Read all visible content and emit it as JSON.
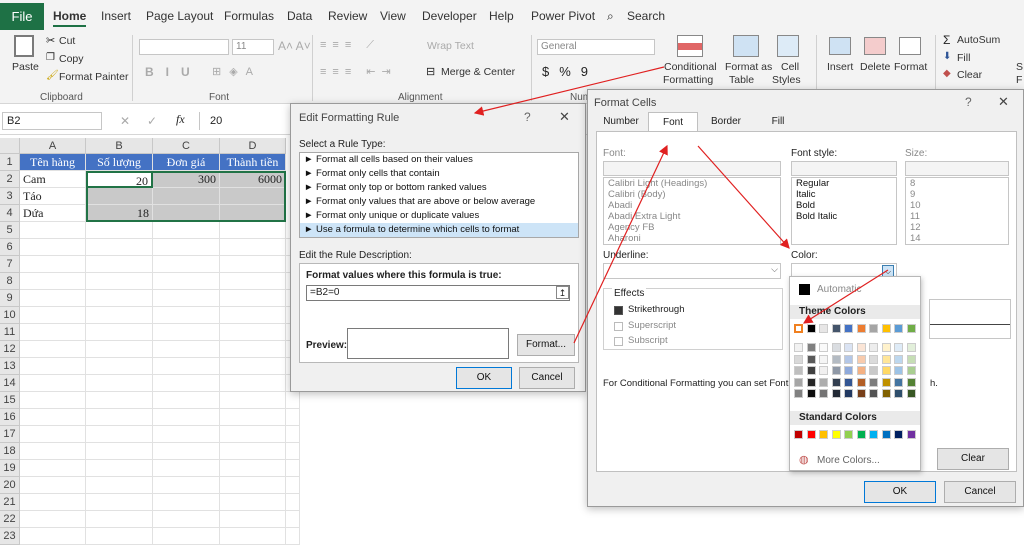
{
  "ribbon": {
    "tabs": [
      "File",
      "Home",
      "Insert",
      "Page Layout",
      "Formulas",
      "Data",
      "Review",
      "View",
      "Developer",
      "Help",
      "Power Pivot"
    ],
    "search": "Search",
    "clipboard": {
      "paste": "Paste",
      "cut": "Cut",
      "copy": "Copy",
      "painter": "Format Painter",
      "group": "Clipboard"
    },
    "font": {
      "size": "11",
      "group": "Font"
    },
    "alignment": {
      "wrap": "Wrap Text",
      "merge": "Merge & Center",
      "group": "Alignment"
    },
    "number": {
      "format": "General",
      "group": "Num"
    },
    "styles": {
      "cond1": "Conditional",
      "cond2": "Formatting",
      "fat1": "Format as",
      "fat2": "Table",
      "cell1": "Cell",
      "cell2": "Styles"
    },
    "cells": {
      "insert": "Insert",
      "delete": "Delete",
      "format": "Format"
    },
    "editing": {
      "autosum": "AutoSum",
      "fill": "Fill",
      "clear": "Clear",
      "s": "S",
      "f": "F"
    }
  },
  "formula_bar": {
    "name_box": "B2",
    "formula": "20"
  },
  "sheet": {
    "columns": [
      "A",
      "B",
      "C",
      "D"
    ],
    "rows": [
      "1",
      "2",
      "3",
      "4",
      "5",
      "6",
      "7",
      "8",
      "9",
      "10",
      "11",
      "12",
      "13",
      "14",
      "15",
      "16",
      "17",
      "18",
      "19",
      "20",
      "21",
      "22",
      "23"
    ],
    "header": [
      "Tên hàng",
      "Số lượng",
      "Đơn giá",
      "Thành tiền"
    ],
    "r2": [
      "Cam",
      "20",
      "300",
      "6000"
    ],
    "r3": [
      "Táo",
      "",
      "",
      ""
    ],
    "r4": [
      "Dứa",
      "18",
      "",
      ""
    ]
  },
  "edit_rule": {
    "title": "Edit Formatting Rule",
    "select_label": "Select a Rule Type:",
    "rules": [
      "► Format all cells based on their values",
      "► Format only cells that contain",
      "► Format only top or bottom ranked values",
      "► Format only values that are above or below average",
      "► Format only unique or duplicate values",
      "► Use a formula to determine which cells to format"
    ],
    "edit_label": "Edit the Rule Description:",
    "formula_label": "Format values where this formula is true:",
    "formula": "=B2=0",
    "preview": "Preview:",
    "format_btn": "Format...",
    "ok": "OK",
    "cancel": "Cancel"
  },
  "format_cells": {
    "title": "Format Cells",
    "tabs": [
      "Number",
      "Font",
      "Border",
      "Fill"
    ],
    "font_label": "Font:",
    "fonts": [
      "Calibri Light (Headings)",
      "Calibri (Body)",
      "Abadi",
      "Abadi Extra Light",
      "Agency FB",
      "Aharoni"
    ],
    "style_label": "Font style:",
    "styles": [
      "Regular",
      "Italic",
      "Bold",
      "Bold Italic"
    ],
    "size_label": "Size:",
    "sizes": [
      "8",
      "9",
      "10",
      "11",
      "12",
      "14"
    ],
    "underline_label": "Underline:",
    "color_label": "Color:",
    "effects": "Effects",
    "strike": "Strikethrough",
    "super": "Superscript",
    "sub": "Subscript",
    "note": "For Conditional Formatting you can set Font Style,",
    "note_end": "h.",
    "clear": "Clear",
    "ok": "OK",
    "cancel": "Cancel"
  },
  "color_picker": {
    "automatic": "Automatic",
    "theme": "Theme Colors",
    "standard": "Standard Colors",
    "more": "More Colors...",
    "theme_colors": [
      "#ffffff",
      "#000000",
      "#e7e6e6",
      "#44546a",
      "#4472c4",
      "#ed7d31",
      "#a5a5a5",
      "#ffc000",
      "#5b9bd5",
      "#70ad47"
    ],
    "standard_colors": [
      "#c00000",
      "#ff0000",
      "#ffc000",
      "#ffff00",
      "#92d050",
      "#00b050",
      "#00b0f0",
      "#0070c0",
      "#002060",
      "#7030a0"
    ]
  }
}
